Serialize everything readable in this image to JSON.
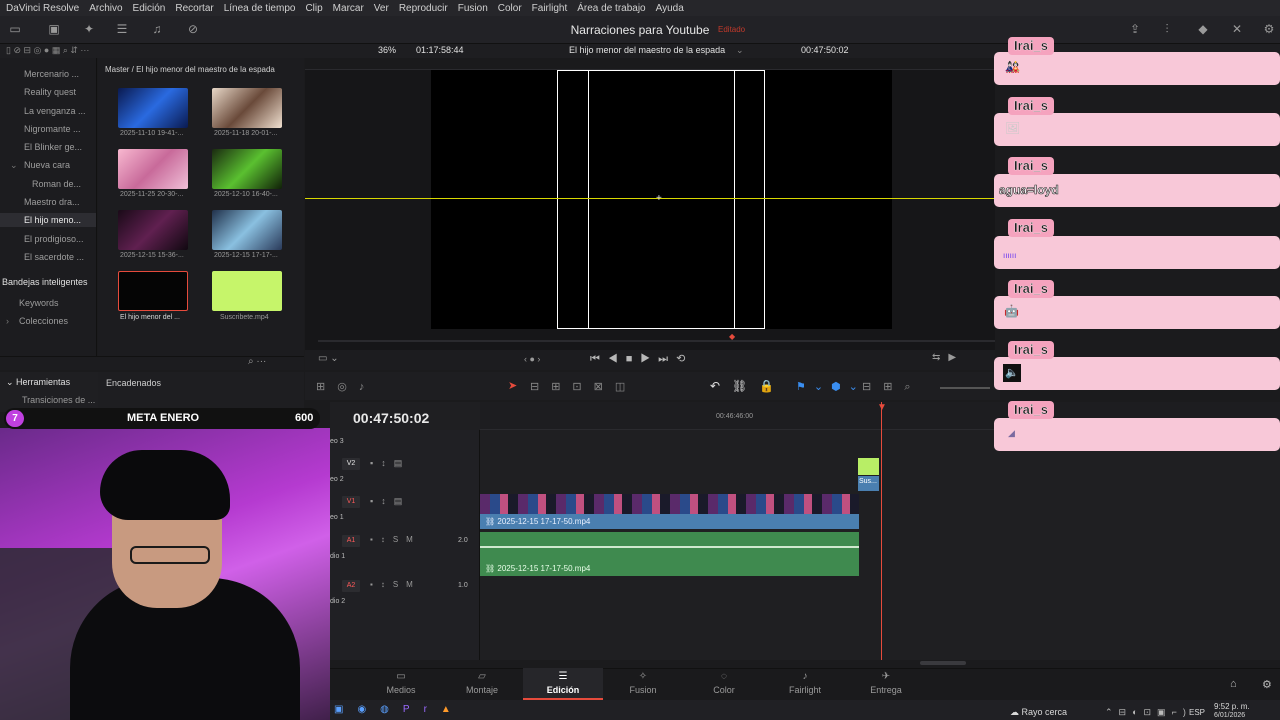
{
  "menu": [
    "DaVinci Resolve",
    "Archivo",
    "Edición",
    "Recortar",
    "Línea de tiempo",
    "Clip",
    "Marcar",
    "Ver",
    "Reproducir",
    "Fusion",
    "Color",
    "Fairlight",
    "Área de trabajo",
    "Ayuda"
  ],
  "header": {
    "project_title": "Narraciones para Youtube",
    "project_status": "Editado"
  },
  "viewer_bar": {
    "zoom": "36%",
    "timecode_left": "01:17:58:44",
    "timeline_name": "El hijo menor del maestro de la espada",
    "timecode_right": "00:47:50:02"
  },
  "sidebar": {
    "items": [
      "Mercenario ...",
      "Reality quest",
      "La venganza ...",
      "Nigromante ...",
      "El Blinker ge...",
      "Nueva cara",
      "Roman de...",
      "Maestro dra...",
      "El hijo meno...",
      "El prodigioso...",
      "El sacerdote ..."
    ],
    "smart_bins_title": "Bandejas inteligentes",
    "smart_bins": [
      "Keywords",
      "Colecciones"
    ]
  },
  "mediapool": {
    "breadcrumb": "Master / El hijo menor del maestro de la espada",
    "clips": [
      {
        "label": "2025-11-10 19-41-..."
      },
      {
        "label": "2025-11-18 20-01-..."
      },
      {
        "label": "2025-11-25 20-30-..."
      },
      {
        "label": "2025-12-10 16-40-..."
      },
      {
        "label": "2025-12-15 15-36-..."
      },
      {
        "label": "2025-12-15 17-17-..."
      },
      {
        "label": "El hijo menor del ..."
      },
      {
        "label": "Suscribete.mp4"
      }
    ]
  },
  "tools_panel": {
    "herramientas": "Herramientas",
    "transiciones": "Transiciones de ...",
    "encadenados": "Encadenados"
  },
  "timeline": {
    "timecode": "00:47:50:02",
    "ruler_mark": "00:46:46:00",
    "tracks": [
      {
        "id": "V3",
        "name": "eo 3"
      },
      {
        "id": "V2",
        "name": "eo 2"
      },
      {
        "id": "V1",
        "name": "eo 1"
      },
      {
        "id": "A1",
        "name": "dio 1",
        "level": "2.0"
      },
      {
        "id": "A2",
        "name": "dio 2",
        "level": "1.0"
      }
    ],
    "clip_video": "2025-12-15 17-17-50.mp4",
    "clip_audio": "2025-12-15 17-17-50.mp4",
    "clip_sus": "Sus..."
  },
  "pages": [
    "Medios",
    "Montaje",
    "Edición",
    "Fusion",
    "Color",
    "Fairlight",
    "Entrega"
  ],
  "active_page": "Edición",
  "goal": {
    "count": "7",
    "label": "META ENERO",
    "target": "600"
  },
  "chat": [
    {
      "user": "Irai_s",
      "msg": "🎎"
    },
    {
      "user": "Irai_s",
      "msg": "🖼"
    },
    {
      "user": "Irai_s",
      "msg": "agua=loyd"
    },
    {
      "user": "Irai_s",
      "msg": "ıııııı"
    },
    {
      "user": "Irai_s",
      "msg": "🤖"
    },
    {
      "user": "Irai_s",
      "msg": "🔈"
    },
    {
      "user": "Irai_s",
      "msg": "◢"
    }
  ],
  "taskbar": {
    "weather": "Rayo cerca",
    "lang": "ESP",
    "time": "9:52 p. m.",
    "date": "6/01/2026"
  },
  "colors": {
    "accent": "#e64b3c",
    "playhead": "#e64b3c",
    "video_clip": "#4a7fb0",
    "audio_clip": "#3f8a4f",
    "chat_bg": "#f8c8d8"
  }
}
